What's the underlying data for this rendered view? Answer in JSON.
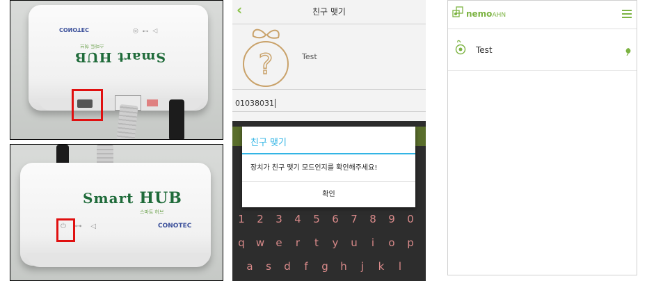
{
  "photo_top": {
    "logo": "CONOTEC",
    "brand": "Smart HUB",
    "sub": "스마트 허브"
  },
  "photo_bottom": {
    "brand_a": "Smart",
    "brand_b": "HUB",
    "sub": "스마트 허브",
    "logo": "CONOTEC"
  },
  "phone": {
    "title": "친구 맺기",
    "contact_name": "Test",
    "phone_number": "01038031",
    "dialog_title": "친구 맺기",
    "dialog_message": "장치가 친구 맺기 모드인지를 확인해주세요!",
    "dialog_button": "확인",
    "keyboard_row_numbers": [
      "1",
      "2",
      "3",
      "4",
      "5",
      "6",
      "7",
      "8",
      "9",
      "0"
    ],
    "keyboard_row_top": [
      "q",
      "w",
      "e",
      "r",
      "t",
      "y",
      "u",
      "i",
      "o",
      "p"
    ],
    "keyboard_row_mid": [
      "a",
      "s",
      "d",
      "f",
      "g",
      "h",
      "j",
      "k",
      "l"
    ],
    "accent_color": "#33b5e5",
    "keyboard_color": "#2d2d2d"
  },
  "app": {
    "logo_a": "nemo",
    "logo_b": "AHN",
    "item_label": "Test",
    "accent_color": "#7cb342",
    "menu_icon": "hamburger-icon",
    "item_icon": "pear-icon",
    "status_icon": "leaf-icon"
  }
}
